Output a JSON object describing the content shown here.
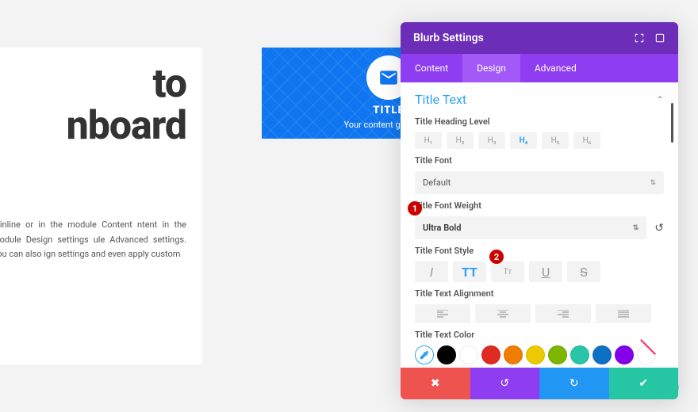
{
  "page": {
    "big_title": "to\nnboard",
    "para": "t inline or in the module Content ntent in the module Design settings ule Advanced settings. You can also ign settings and even apply custom"
  },
  "blurb": {
    "title": "TITLE",
    "content": "Your content goes here"
  },
  "panel": {
    "title": "Blurb Settings",
    "tabs": {
      "content": "Content",
      "design": "Design",
      "advanced": "Advanced"
    },
    "section": "Title Text",
    "labels": {
      "heading_level": "Title Heading Level",
      "font": "Title Font",
      "font_weight": "Title Font Weight",
      "font_style": "Title Font Style",
      "alignment": "Title Text Alignment",
      "color": "Title Text Color"
    },
    "heading_levels": [
      "H₁",
      "H₂",
      "H₃",
      "H₄",
      "H₅",
      "H₆"
    ],
    "font_value": "Default",
    "weight_value": "Ultra Bold",
    "colors": [
      "#000000",
      "#ffffff",
      "#e02b20",
      "#ef7d00",
      "#ecc900",
      "#7db500",
      "#29c4a9",
      "#0c71c3",
      "#8300e9"
    ]
  },
  "badges": {
    "one": "1",
    "two": "2"
  }
}
